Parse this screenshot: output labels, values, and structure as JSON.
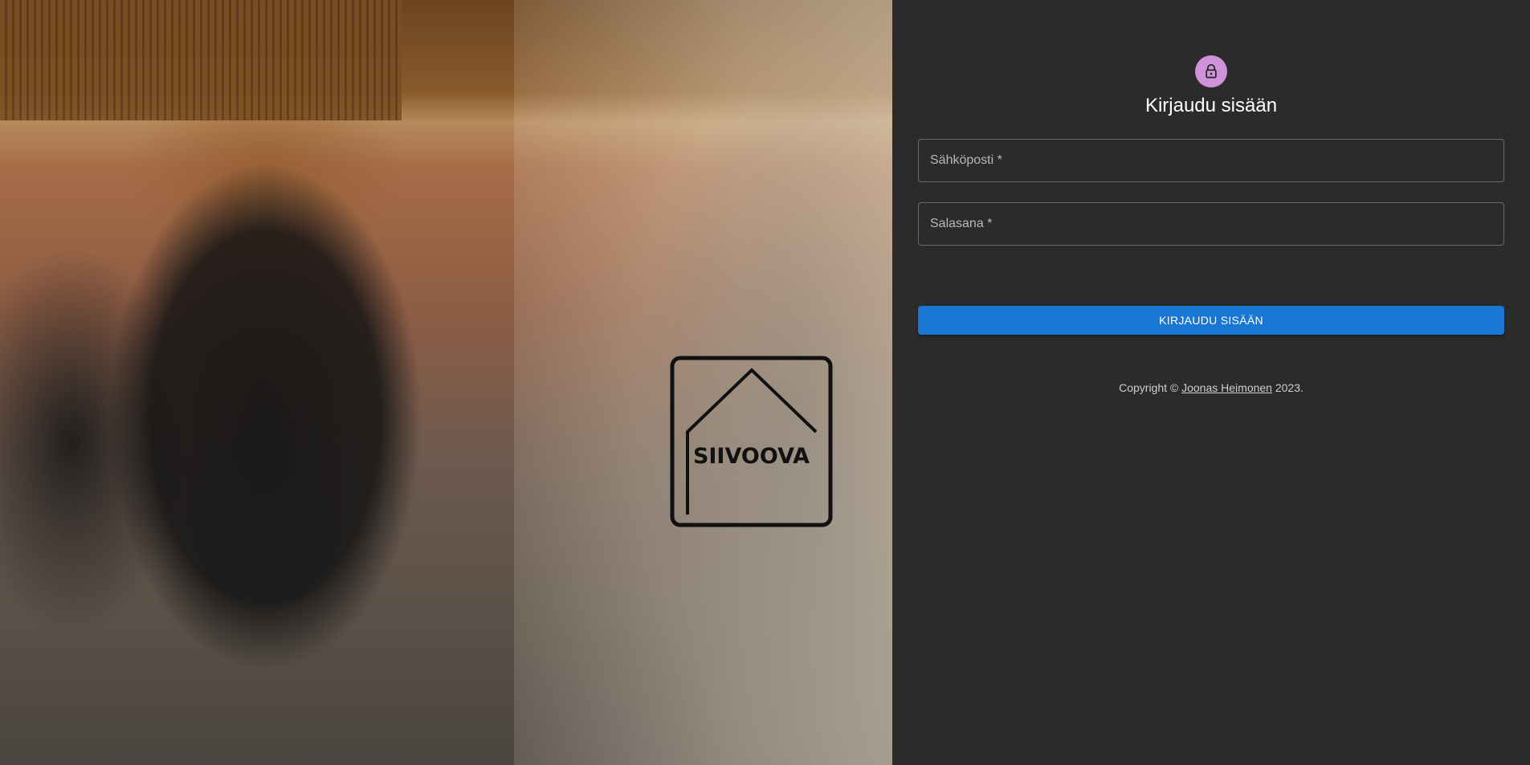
{
  "hero": {
    "logo_text": "SIIVOOVA",
    "logo_icon": "house-outline-icon"
  },
  "login": {
    "avatar_icon": "lock-icon",
    "avatar_color": "#ce93d8",
    "title": "Kirjaudu sisään",
    "email_label": "Sähköposti *",
    "email_value": "",
    "password_label": "Salasana *",
    "password_value": "",
    "submit_label": "KIRJAUDU SISÄÄN",
    "submit_color": "#1976d2"
  },
  "footer": {
    "copyright_prefix": "Copyright © ",
    "author": "Joonas Heimonen",
    "copyright_suffix": " 2023."
  }
}
